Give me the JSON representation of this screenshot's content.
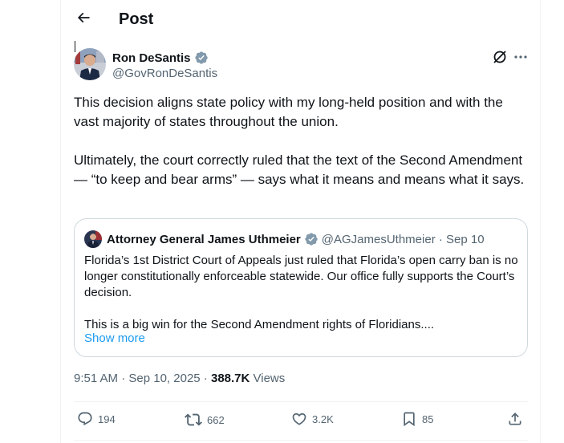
{
  "header": {
    "title": "Post"
  },
  "author": {
    "name": "Ron DeSantis",
    "handle": "@GovRonDeSantis"
  },
  "post": {
    "paragraphs": [
      "This decision aligns state policy with my long-held position and with the vast majority of states throughout the union.",
      "Ultimately, the court correctly ruled that the text of the Second Amendment — “to keep and bear arms” — says what it means and means what it says."
    ]
  },
  "quote": {
    "name": "Attorney General James Uthmeier",
    "handle": "@AGJamesUthmeier",
    "separator": " · ",
    "date": "Sep 10",
    "paragraphs": [
      "Florida’s 1st District Court of Appeals just ruled that Florida’s open carry ban is no longer constitutionally enforceable statewide. Our office fully supports the Court’s decision.",
      "This is a big win for the Second Amendment rights of Floridians...."
    ],
    "show_more": "Show more"
  },
  "meta": {
    "time": "9:51 AM",
    "separator": " · ",
    "date": "Sep 10, 2025",
    "separator2": " · ",
    "views_count": "388.7K",
    "views_label": " Views"
  },
  "actions": {
    "replies": "194",
    "reposts": "662",
    "likes": "3.2K",
    "bookmarks": "85"
  },
  "colors": {
    "verified": "#829aab",
    "link": "#1d9bf0",
    "secondary_text": "#536471"
  }
}
